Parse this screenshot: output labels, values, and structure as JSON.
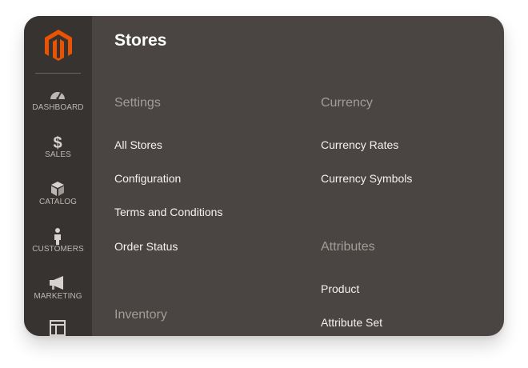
{
  "sidebar": {
    "logo": "magento-logo",
    "items": [
      {
        "label": "DASHBOARD",
        "icon": "speedometer-icon"
      },
      {
        "label": "SALES",
        "icon": "dollar-icon"
      },
      {
        "label": "CATALOG",
        "icon": "cube-icon"
      },
      {
        "label": "CUSTOMERS",
        "icon": "person-icon"
      },
      {
        "label": "MARKETING",
        "icon": "megaphone-icon"
      },
      {
        "label": "",
        "icon": "content-icon"
      }
    ]
  },
  "panel": {
    "title": "Stores",
    "settings": {
      "title": "Settings",
      "links": [
        "All Stores",
        "Configuration",
        "Terms and Conditions",
        "Order Status"
      ]
    },
    "inventory": {
      "title": "Inventory"
    },
    "currency": {
      "title": "Currency",
      "links": [
        "Currency Rates",
        "Currency Symbols"
      ]
    },
    "attributes": {
      "title": "Attributes",
      "links": [
        "Product",
        "Attribute Set"
      ]
    }
  },
  "colors": {
    "sidebar_bg": "#373330",
    "panel_bg": "#4a4542",
    "accent": "#eb5202",
    "group_title": "#a29d99"
  }
}
